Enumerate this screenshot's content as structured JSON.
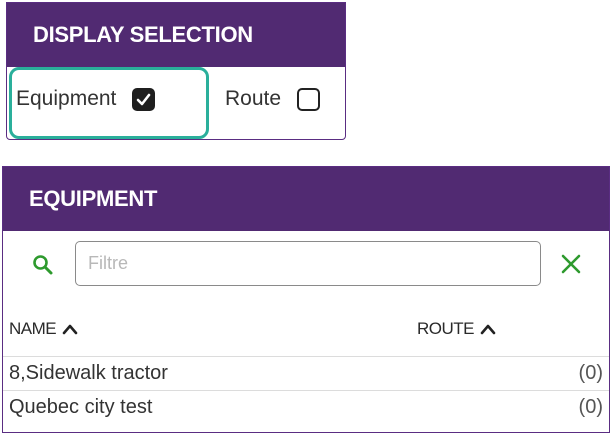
{
  "display_selection": {
    "title": "DISPLAY SELECTION",
    "options": [
      {
        "label": "Equipment",
        "checked": true
      },
      {
        "label": "Route",
        "checked": false
      }
    ]
  },
  "equipment": {
    "title": "EQUIPMENT",
    "filter": {
      "placeholder": "Filtre",
      "value": ""
    },
    "columns": [
      {
        "label": "NAME",
        "sort": "ascending",
        "icon": "chevron-up-icon"
      },
      {
        "label": "ROUTE",
        "sort": "ascending",
        "icon": "chevron-up-icon"
      }
    ],
    "rows": [
      {
        "name": "8,Sidewalk tractor",
        "route_count": "(0)"
      },
      {
        "name": "Quebec city test",
        "route_count": "(0)"
      }
    ]
  },
  "colors": {
    "header_bg": "#512a72",
    "highlight": "#2aaf9b",
    "icon_green": "#2e9a2e"
  }
}
